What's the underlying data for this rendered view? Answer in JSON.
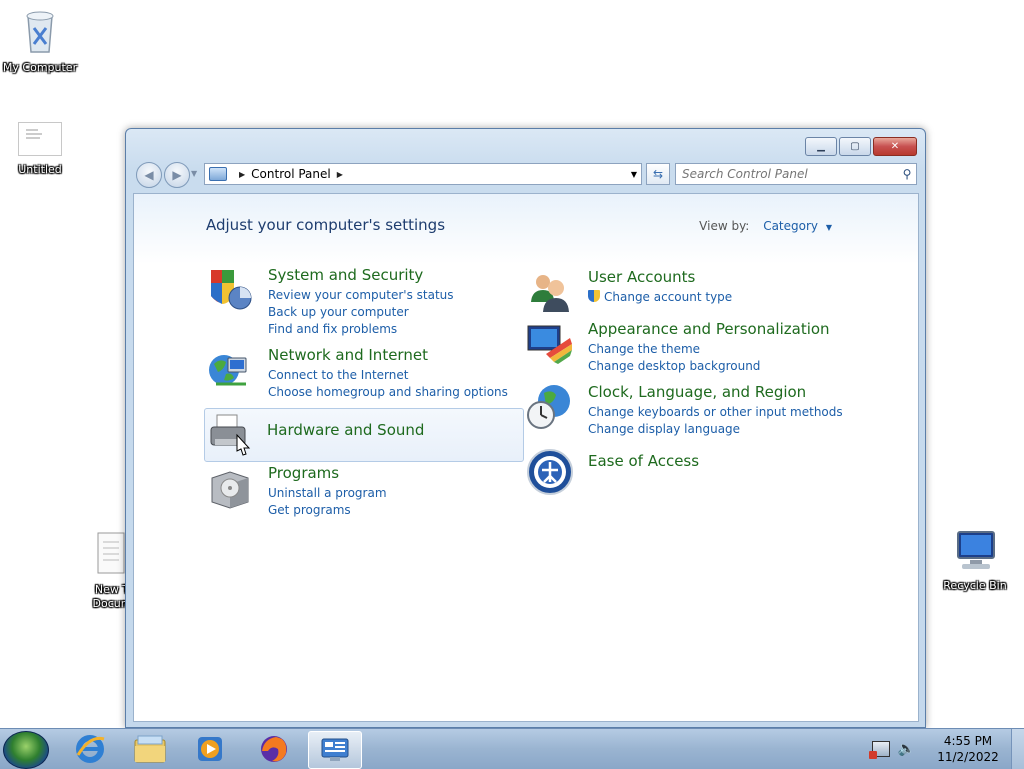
{
  "desktop": {
    "icons": [
      {
        "label": "My Computer",
        "icon": "recycle-bin-icon"
      },
      {
        "label": "Untitled",
        "icon": "document-thumbnail-icon"
      },
      {
        "label": "New T\nDocum",
        "icon": "text-document-icon"
      },
      {
        "label": "Recycle Bin",
        "icon": "computer-icon"
      }
    ]
  },
  "window": {
    "title": "Control Panel",
    "address": {
      "crumb": "Control Panel"
    },
    "search": {
      "placeholder": "Search Control Panel"
    },
    "heading": "Adjust your computer's settings",
    "view_by": {
      "label": "View by:",
      "value": "Category"
    },
    "categories": [
      {
        "title": "System and Security",
        "links": [
          "Review your computer's status",
          "Back up your computer",
          "Find and fix problems"
        ],
        "icon": "shield-icon"
      },
      {
        "title": "Network and Internet",
        "links": [
          "Connect to the Internet",
          "Choose homegroup and sharing options"
        ],
        "icon": "network-globe-icon"
      },
      {
        "title": "Hardware and Sound",
        "links": [],
        "icon": "printer-icon"
      },
      {
        "title": "Programs",
        "links": [
          "Uninstall a program",
          "Get programs"
        ],
        "icon": "programs-box-icon"
      },
      {
        "title": "User Accounts",
        "links": [
          "Change account type"
        ],
        "icon": "users-icon"
      },
      {
        "title": "Appearance and Personalization",
        "links": [
          "Change the theme",
          "Change desktop background"
        ],
        "icon": "monitor-palette-icon"
      },
      {
        "title": "Clock, Language, and Region",
        "links": [
          "Change keyboards or other input methods",
          "Change display language"
        ],
        "icon": "clock-globe-icon"
      },
      {
        "title": "Ease of Access",
        "links": [],
        "icon": "ease-of-access-icon"
      }
    ]
  },
  "taskbar": {
    "items": [
      "start-orb-icon",
      "internet-explorer-icon",
      "file-explorer-icon",
      "media-player-icon",
      "firefox-icon",
      "control-panel-icon"
    ],
    "clock": {
      "time": "4:55 PM",
      "date": "11/2/2022"
    }
  }
}
